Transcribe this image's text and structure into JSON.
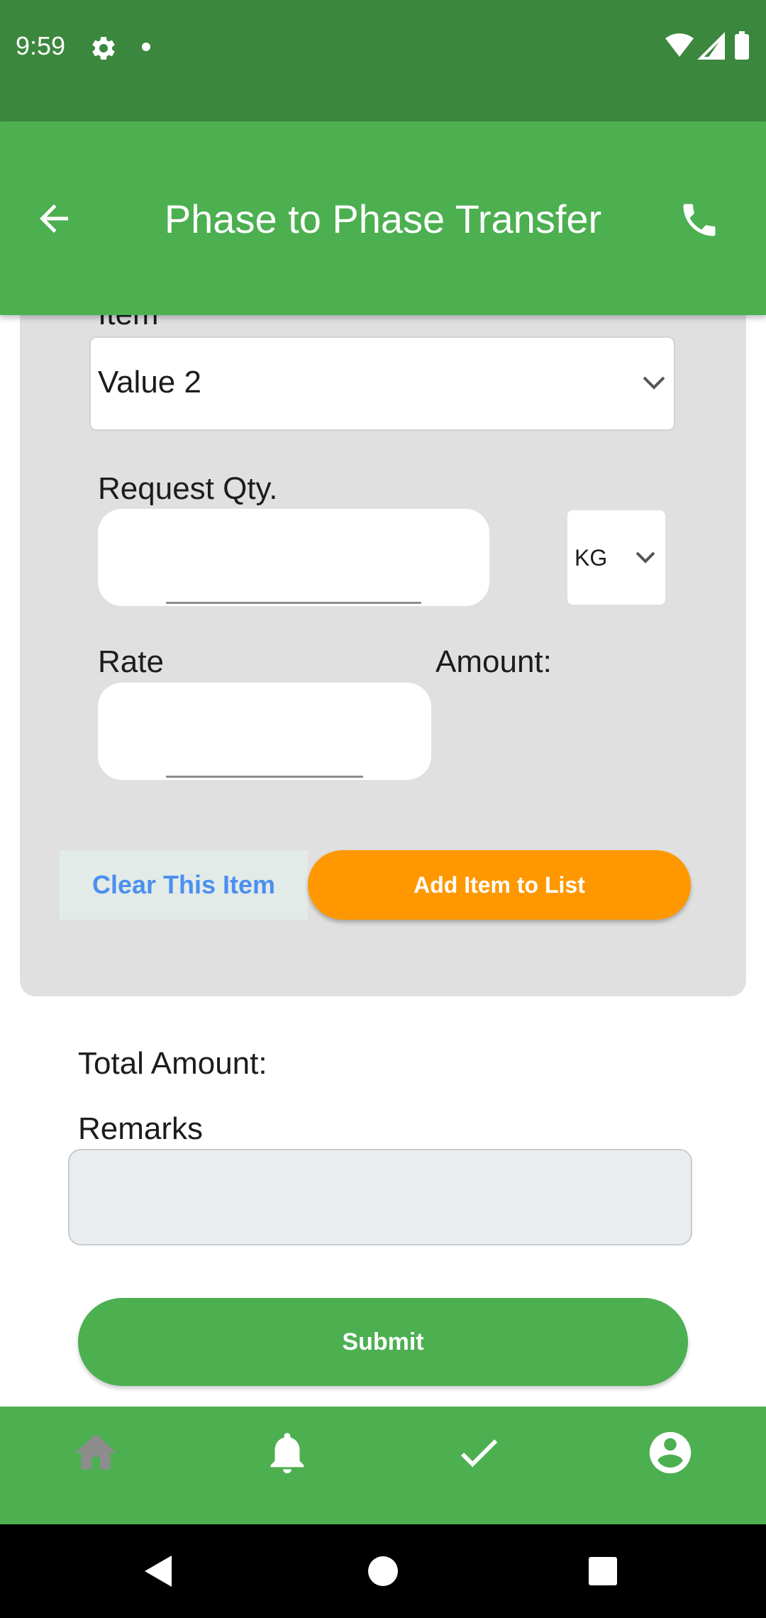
{
  "status_bar": {
    "time": "9:59",
    "icons": [
      "gear-icon",
      "notification-dot",
      "wifi-icon",
      "signal-icon",
      "battery-icon"
    ]
  },
  "app_bar": {
    "title": "Phase to Phase Transfer",
    "back_icon": "arrow-back-icon",
    "call_icon": "phone-icon"
  },
  "form": {
    "item_label": "Item",
    "item_value": "Value 2",
    "request_qty_label": "Request Qty.",
    "request_qty_value": "",
    "unit_value": "KG",
    "rate_label": "Rate",
    "rate_value": "",
    "amount_label": "Amount:",
    "clear_button": "Clear This Item",
    "add_button": "Add Item to List"
  },
  "summary": {
    "total_amount_label": "Total Amount:",
    "remarks_label": "Remarks",
    "remarks_value": "",
    "submit_button": "Submit"
  },
  "bottom_nav": {
    "items": [
      {
        "icon": "home-icon",
        "active": false
      },
      {
        "icon": "bell-icon",
        "active": true
      },
      {
        "icon": "check-icon",
        "active": true
      },
      {
        "icon": "account-icon",
        "active": true
      }
    ]
  },
  "colors": {
    "status_bar": "#3b873e",
    "primary": "#4caf50",
    "accent": "#ff9800",
    "card": "#e0e0e0",
    "link": "#4d8ff0"
  }
}
